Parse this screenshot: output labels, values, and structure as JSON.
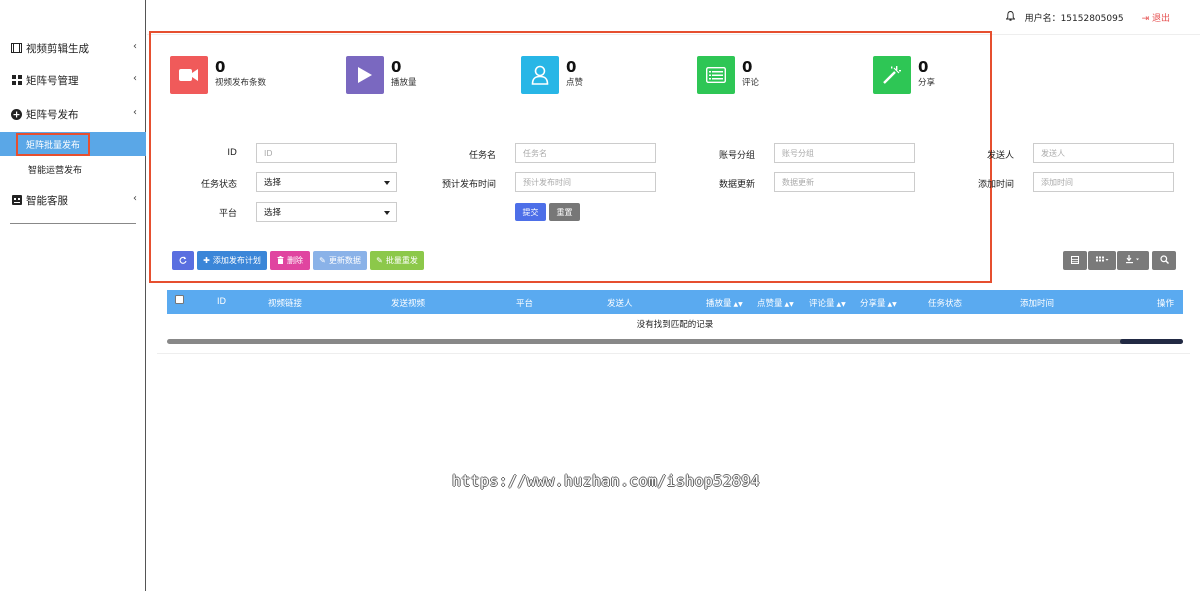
{
  "sidebar": {
    "items": [
      {
        "label": "视频剪辑生成",
        "icon": "film-icon"
      },
      {
        "label": "矩阵号管理",
        "icon": "grid-icon"
      },
      {
        "label": "矩阵号发布",
        "icon": "plus-circle-icon"
      },
      {
        "label": "智能客服",
        "icon": "robot-icon"
      }
    ],
    "sub_items": [
      {
        "label": "矩阵批量发布",
        "active": true
      },
      {
        "label": "智能运营发布",
        "active": false
      }
    ]
  },
  "header": {
    "user_label": "用户名：15152805095",
    "logout_label": "退出"
  },
  "stats": [
    {
      "value": "0",
      "label": "视频发布条数",
      "color": "#f05a5a",
      "icon": "video-camera-icon"
    },
    {
      "value": "0",
      "label": "播放量",
      "color": "#7a68c0",
      "icon": "play-icon"
    },
    {
      "value": "0",
      "label": "点赞",
      "color": "#28b6e6",
      "icon": "user-icon"
    },
    {
      "value": "0",
      "label": "评论",
      "color": "#2ec655",
      "icon": "list-icon"
    },
    {
      "value": "0",
      "label": "分享",
      "color": "#2ec655",
      "icon": "magic-wand-icon"
    }
  ],
  "form": {
    "id_label": "ID",
    "id_placeholder": "ID",
    "task_name_label": "任务名",
    "task_name_placeholder": "任务名",
    "account_group_label": "账号分组",
    "account_group_placeholder": "账号分组",
    "sender_label": "发送人",
    "sender_placeholder": "发送人",
    "task_status_label": "任务状态",
    "task_status_value": "选择",
    "scheduled_time_label": "预计发布时间",
    "scheduled_time_placeholder": "预计发布时间",
    "data_update_label": "数据更新",
    "data_update_placeholder": "数据更新",
    "added_time_label": "添加时间",
    "added_time_placeholder": "添加时间",
    "platform_label": "平台",
    "platform_value": "选择",
    "submit_label": "提交",
    "reset_label": "重置"
  },
  "toolbar": {
    "add_label": "添加发布计划",
    "delete_label": "删除",
    "update_label": "更新数据",
    "batch_label": "批量重发"
  },
  "table": {
    "headers": [
      "ID",
      "视频链接",
      "发送视频",
      "平台",
      "发送人",
      "播放量",
      "点赞量",
      "评论量",
      "分享量",
      "任务状态",
      "添加时间",
      "操作"
    ],
    "empty_text": "没有找到匹配的记录"
  },
  "watermark": "https://www.huzhan.com/ishop52894"
}
